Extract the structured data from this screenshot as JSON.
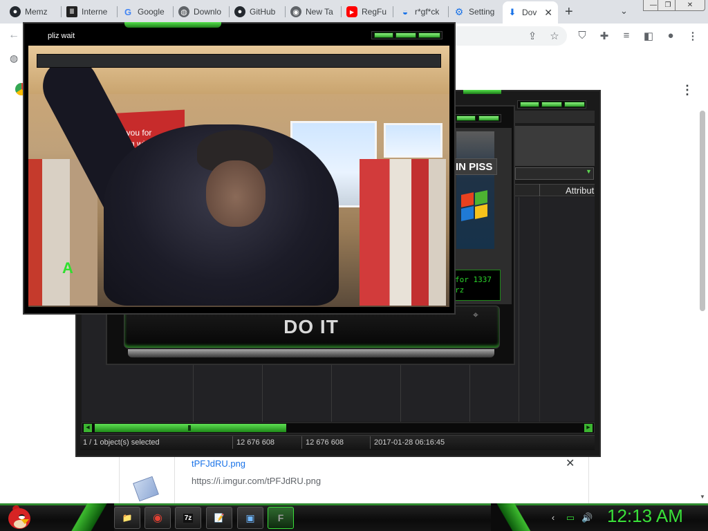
{
  "browser": {
    "tabs": [
      {
        "label": "Memz",
        "icon": "github-icon"
      },
      {
        "label": "Interne",
        "icon": "archive-icon"
      },
      {
        "label": "Google",
        "icon": "google-icon"
      },
      {
        "label": "Downlo",
        "icon": "globe-icon"
      },
      {
        "label": "GitHub",
        "icon": "github-icon"
      },
      {
        "label": "New Ta",
        "icon": "chrome-icon"
      },
      {
        "label": "RegFu",
        "icon": "youtube-icon"
      },
      {
        "label": "r*gf*ck",
        "icon": "edge-icon"
      },
      {
        "label": "Setting",
        "icon": "gear-icon"
      },
      {
        "label": "Dov",
        "icon": "download-icon",
        "active": true
      }
    ],
    "new_tab_glyph": "+",
    "tab_close_glyph": "✕",
    "window_controls": {
      "minimize": "—",
      "maximize": "❐",
      "close": "✕"
    }
  },
  "download_item": {
    "filename": "tPFJdRU.png",
    "url": "https://i.imgur.com/tPFJdRU.png",
    "close_glyph": "✕"
  },
  "video_window": {
    "title": "pliz wait",
    "overlay_letter": "A",
    "sign_text": "Thank you for shopping with"
  },
  "installer_dialog": {
    "tagline": "IN PISS",
    "console_lines": [
      "for 1337",
      "rz"
    ],
    "button_label": "DO IT"
  },
  "file_manager": {
    "column_header": "Attribut",
    "status": {
      "selection": "1 / 1 object(s) selected",
      "size": "12 676 608",
      "packed_size": "12 676 608",
      "modified": "2017-01-28 06:16:45"
    }
  },
  "taskbar": {
    "pinned": [
      {
        "name": "file-explorer",
        "glyph": "📁"
      },
      {
        "name": "chrome",
        "glyph": "◉"
      },
      {
        "name": "7zip",
        "glyph": "7z"
      },
      {
        "name": "notepad",
        "glyph": "📝"
      },
      {
        "name": "control-panel",
        "glyph": "▣"
      },
      {
        "name": "app-f",
        "glyph": "F"
      }
    ],
    "clock": "12:13 AM"
  },
  "colors": {
    "accent_green": "#39e039",
    "link_blue": "#1a73e8",
    "dark_panel": "#1a1a1a"
  }
}
